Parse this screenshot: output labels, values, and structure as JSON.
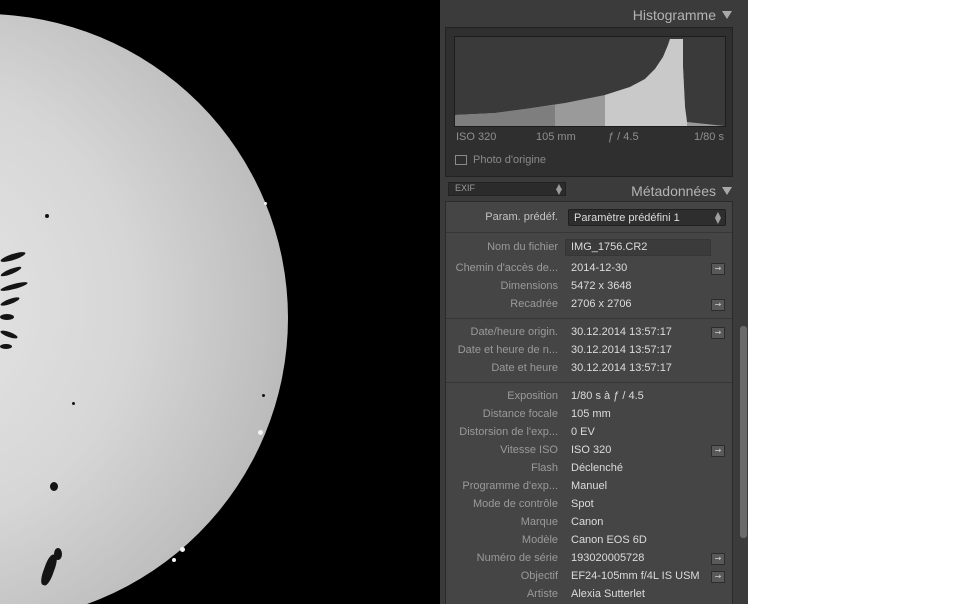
{
  "histogram": {
    "title": "Histogramme",
    "iso": "ISO 320",
    "focal": "105 mm",
    "aperture": "ƒ / 4.5",
    "shutter": "1/80 s",
    "original_photo_label": "Photo d'origine"
  },
  "metadata": {
    "title": "Métadonnées",
    "view_select": "EXIF",
    "preset_label": "Param. prédéf.",
    "preset_value": "Paramètre prédéfini 1",
    "rows": [
      {
        "label": "Nom du fichier",
        "value": "IMG_1756.CR2"
      },
      {
        "label": "Chemin d'accès de...",
        "value": "2014-12-30"
      },
      {
        "label": "Dimensions",
        "value": "5472 x 3648"
      },
      {
        "label": "Recadrée",
        "value": "2706 x 2706"
      },
      {
        "label": "Date/heure origin.",
        "value": "30.12.2014 13:57:17"
      },
      {
        "label": "Date et heure de n...",
        "value": "30.12.2014 13:57:17"
      },
      {
        "label": "Date et heure",
        "value": "30.12.2014 13:57:17"
      },
      {
        "label": "Exposition",
        "value": "1/80 s à ƒ / 4.5"
      },
      {
        "label": "Distance focale",
        "value": "105 mm"
      },
      {
        "label": "Distorsion de l'exp...",
        "value": "0 EV"
      },
      {
        "label": "Vitesse ISO",
        "value": "ISO 320"
      },
      {
        "label": "Flash",
        "value": "Déclenché"
      },
      {
        "label": "Programme d'exp...",
        "value": "Manuel"
      },
      {
        "label": "Mode de contrôle",
        "value": "Spot"
      },
      {
        "label": "Marque",
        "value": "Canon"
      },
      {
        "label": "Modèle",
        "value": "Canon EOS 6D"
      },
      {
        "label": "Numéro de série",
        "value": "193020005728"
      },
      {
        "label": "Objectif",
        "value": "EF24-105mm f/4L IS USM"
      },
      {
        "label": "Artiste",
        "value": "Alexia Sutterlet"
      }
    ]
  },
  "icons": {
    "go": "→",
    "collapse": "triangle-down",
    "select_arrows": "updown"
  }
}
